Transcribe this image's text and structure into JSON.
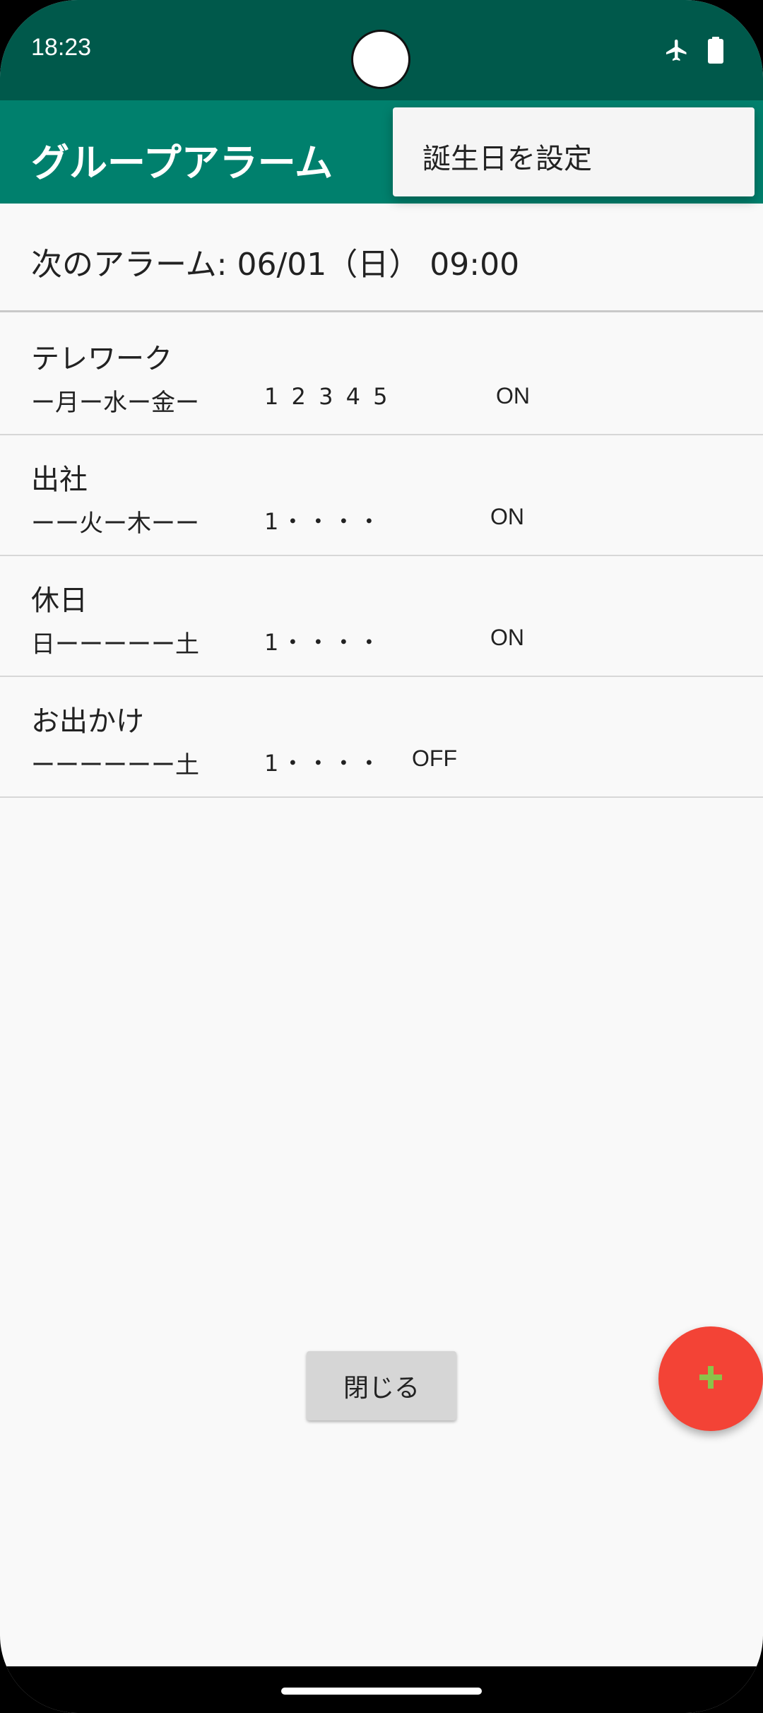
{
  "status_bar": {
    "time": "18:23",
    "icons": [
      "airplane-icon",
      "battery-icon"
    ]
  },
  "app_bar": {
    "title": "グループアラーム"
  },
  "popup_menu": {
    "items": [
      {
        "label": "誕生日を設定"
      }
    ]
  },
  "next_alarm": {
    "text": "次のアラーム: 06/01（日） 09:00"
  },
  "alarm_groups": [
    {
      "name": "テレワーク",
      "days": "ー月ー水ー金ー",
      "numbers": "1 2 3 4 5",
      "state": "ON"
    },
    {
      "name": "出社",
      "days": "ーー火ー木ーー",
      "numbers": "1・・・・",
      "state": "ON"
    },
    {
      "name": "休日",
      "days": "日ーーーーー土",
      "numbers": "1・・・・",
      "state": "ON"
    },
    {
      "name": "お出かけ",
      "days": "ーーーーーー土",
      "numbers": "1・・・・",
      "state": "OFF"
    }
  ],
  "close_button": {
    "label": "閉じる"
  },
  "fab": {
    "icon": "plus-icon",
    "color": "#f34336",
    "icon_color": "#8bc34a"
  },
  "colors": {
    "status_bar": "#00594b",
    "app_bar": "#00806d",
    "background": "#f9f9f9"
  }
}
